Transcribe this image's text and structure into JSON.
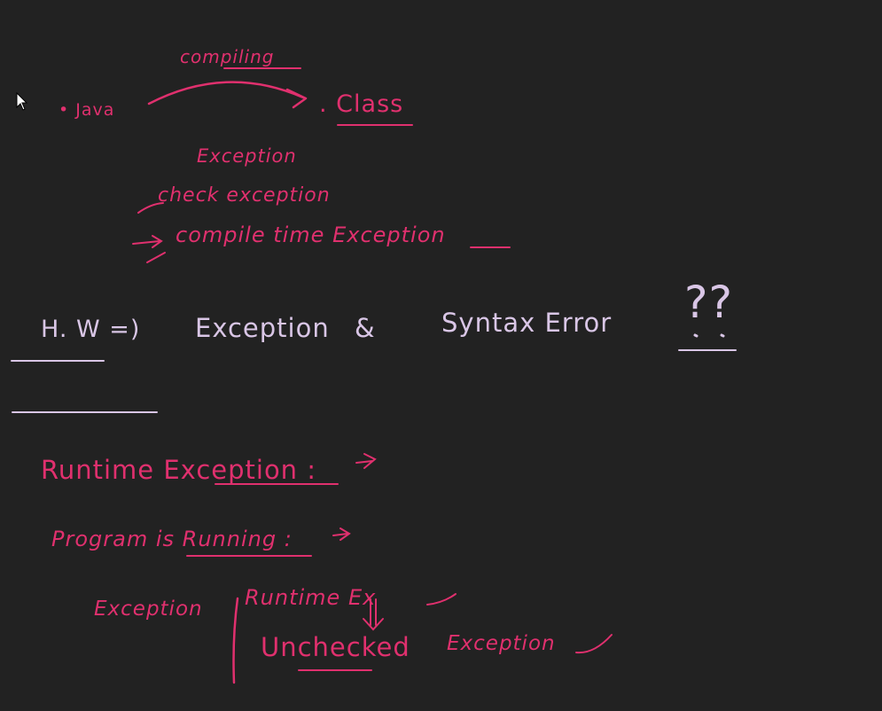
{
  "colors": {
    "background": "#222222",
    "pink_ink": "#e0306e",
    "lavender_ink": "#d9c6e6"
  },
  "notes": {
    "compiling": "compiling",
    "java_ext": "• Java",
    "class_ext": ". Class",
    "exception": "Exception",
    "check_exception": "check exception",
    "compile_time_exception": "compile time Exception",
    "hw_label": "H. W =)",
    "hw_exception": "Exception",
    "hw_and": "&",
    "hw_syntax_error": "Syntax Error",
    "hw_question": "??",
    "runtime_exception": "Runtime Exception :",
    "program_running": "Program is Running :",
    "exception_left": "Exception",
    "runtime_ex": "Runtime Ex",
    "unchecked": "Unchecked",
    "exception_right": "Exception"
  },
  "cursor_icon": "arrow-cursor-icon"
}
